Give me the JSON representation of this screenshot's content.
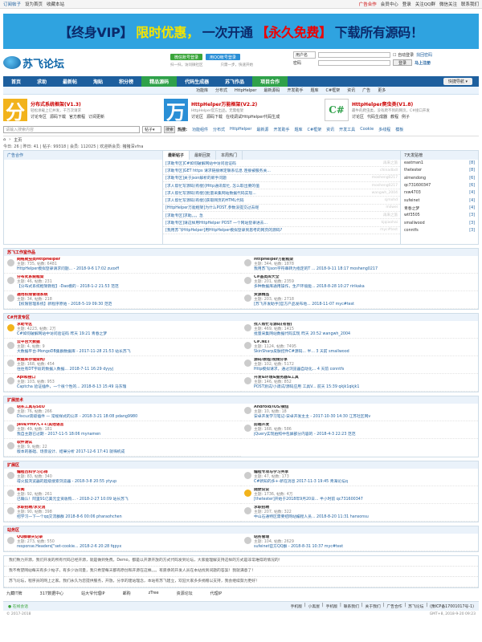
{
  "topbar": {
    "left": [
      "订阅帖子",
      "设为首页",
      "收藏本站"
    ],
    "right_red": "广告合作",
    "right": [
      "会员中心",
      "登录",
      "关注QQ群",
      "微信关注",
      "联系我们"
    ]
  },
  "banner": {
    "p1": "【终身VIP】",
    "p2": "限时优惠，",
    "p3": "一次开通",
    "p4": "【永久免费】",
    "p5": "下载所有源码！"
  },
  "logo": {
    "text": "苏飞论坛"
  },
  "login": {
    "wechat": "微信账号登录",
    "qq": "用QQ帐号登录",
    "wechat_sub": "扫一扫，访问微社区",
    "qq_sub": "只需一步，快速开始"
  },
  "form": {
    "account": "用户名",
    "password": "密码",
    "remember": "自动登录",
    "forgot": "找回密码",
    "login_btn": "登录",
    "register": "马上注册"
  },
  "nav": {
    "items": [
      "首页",
      "求助",
      "最新帖",
      "淘贴",
      "积分榜",
      "精品源码",
      "代码生成器",
      "苏飞作品",
      "项目合作"
    ],
    "quick": "快捷导航"
  },
  "subnav": [
    "功能库",
    "分布式",
    "HttpHelper",
    "最新源码",
    "开发助手",
    "题库",
    "C#框架",
    "资讯",
    "广告",
    "更多"
  ],
  "promos": [
    {
      "icon": "分",
      "title": "分布式系统框架(V1.3)",
      "desc": "轻松承载上亿并发，千万次请求",
      "links": [
        "讨论专区",
        "源码下载",
        "官方教程",
        "订阅更新"
      ]
    },
    {
      "icon": "万",
      "title": "HttpHelper万能框架(V2.2)",
      "desc": "HttpHelper官方出品，无需框架",
      "links": [
        "讨论区",
        "源码下载",
        "在线调试HttpHelper代码生成"
      ]
    },
    {
      "icon": "C#",
      "title": "HttpHelper爬虫类(V1.8)",
      "desc": "最牛的爬虫类，没有爬不到的网页，C#接口开发",
      "links": [
        "讨论区",
        "代码生成器",
        "教程",
        "例子"
      ]
    }
  ],
  "search": {
    "placeholder": "请输入搜索内容",
    "type": "帖子",
    "button": "搜索",
    "hot_label": "热搜:",
    "hot": [
      "功能组件",
      "分布式",
      "HttpHelper",
      "最新源",
      "开发助手",
      "题库",
      "C#框架",
      "资讯",
      "开发工具",
      "Cookie",
      "多线程",
      "模板"
    ]
  },
  "crumb": [
    "首页",
    "主页"
  ],
  "stats": "今日: 26 | 昨日: 41 | 帖子: 99318 | 会员: 112025 | 欢迎新会员: 猪猪深vfna",
  "ad_title": "广告合作",
  "tabs": [
    "最新帖子",
    "最新回复",
    "本周热门"
  ],
  "new_posts": [
    {
      "t": "[求助专区]C#如何破解网站中访问验证码",
      "u": "再来之旅"
    },
    {
      "t": "[求助专区]GET https 请求链接绑定联系信息 连接被服务关...",
      "u": "chinadbdl"
    },
    {
      "t": "[求助专区]关于json解析的新手问题",
      "u": "mosheng0217"
    },
    {
      "t": "[求人帮忙写源码(有偿)]Http通讯帮忙, 怎么取出要的值",
      "u": "mosheng0217"
    },
    {
      "t": "[求人帮忙写源码(有偿)]批量采集网站数据代码实现...",
      "u": "wangwh_2004"
    },
    {
      "t": "[求人帮忙写源码(有偿)]获取网页的HTML代码",
      "u": "sjmxhd"
    },
    {
      "t": "[HttpHelper万能框架]为什么POST,参数没提交过去呢",
      "u": "milwei"
    },
    {
      "t": "[求助专区]求助。。。急",
      "u": "再来之旅"
    },
    {
      "t": "[求助专区]请这样用HttpHelper POST 一个网站登录进去...",
      "u": "kjqiaohai"
    },
    {
      "t": "[我用苏飞HttpHelper]用HttpHelper模拟登录到思考的网页的源码?",
      "u": "myc#test"
    }
  ],
  "top_users": {
    "title": "7天发贴榜",
    "users": [
      [
        "eastman1",
        "[8]"
      ],
      [
        "thetester",
        "[8]"
      ],
      [
        "almendong",
        "[6]"
      ],
      [
        "qc731600347",
        "[6]"
      ],
      [
        "rxw4703",
        "[4]"
      ],
      [
        "sufeinet",
        "[4]"
      ],
      [
        "青春之梦",
        "[4]"
      ],
      [
        "wtf3505",
        "[3]"
      ],
      [
        "smallwood",
        "[3]"
      ],
      [
        "conntfs",
        "[3]"
      ]
    ]
  },
  "sections": [
    {
      "title": "苏飞工作室作品",
      "forums": [
        {
          "n": "网络爬虫类HttpHelper",
          "c": "主题: 735, 帖数: 6481",
          "l": "HttpHelper模拟登录请求问题... - 2018-9-6 17:02 zuoxff",
          "new": false
        },
        {
          "n": "HttpHelper万能框架",
          "c": "主题: 344, 帖数: 1878",
          "l": "我用苏飞json字符串转为指定的T ... 2018-9-11 18:17 mosheng0217",
          "new": false
        },
        {
          "n": "分布式系统框架",
          "c": "主题: 46, 帖数: 231",
          "l": "【分布式系统框架教程】-Dao模的 - 2018-1-2 21:53 范范",
          "new": false
        },
        {
          "n": "C#基类库大全",
          "c": "主题: 201, 帖数: 2359",
          "l": "多种数据库通用操作，生产环境能... 2018-8-28 10:27 ririkaka",
          "new": false
        },
        {
          "n": "通用权限管理系统",
          "c": "主题: 34, 帖数: 218",
          "l": "【权限管理系统】新程序原始 - 2018-5-19 09:30 范范",
          "new": false
        },
        {
          "n": "资源精品",
          "c": "主题: 203, 帖数: 2718",
          "l": "[苏飞开发助手]官方产品发布地... 2018-11-07 myc#test",
          "new": false
        }
      ]
    },
    {
      "title": "C#开发专区",
      "forums": [
        {
          "n": "求助专区",
          "c": "主题: 4223, 帖数: 2万",
          "l": "C#如何破解网站中访问验证码 昨天 19:21 青春之梦",
          "new": true
        },
        {
          "n": "找人帮忙写源码(有偿)",
          "c": "主题: 469, 帖数: 1415",
          "l": "批量采集网站数据代码实现 昨天 20:52 wangwh_2004",
          "new": false
        },
        {
          "n": "云平台大数据",
          "c": "主题: 4, 帖数: 9",
          "l": "大数据平台-MongoDB集群数据库 - 2017-11-28 21:53 站长苏飞",
          "new": false
        },
        {
          "n": "C#.NET",
          "c": "主题: 1124, 帖数: 7495",
          "l": "SkinSharp皮肤控件C#源码... 半... 3 天前 smallwood",
          "new": false
        },
        {
          "n": "数据库存储架构/",
          "c": "主题: 168, 帖数: 454",
          "l": "往往有DT字段的数据入数据... 2018-7-11 16:29 dyyyj",
          "new": false
        },
        {
          "n": "源码/教程/视频分享",
          "c": "主题: 102, 帖数: 5172",
          "l": "Http模拟请求，通过浏览器自动化... 4 天前 conntfs",
          "new": false
        },
        {
          "n": "Api和接口",
          "c": "主题: 103, 帖数: 953",
          "l": "Captcha 验证插件，一个很个性的... 2018-8-13 15:49 马东瑰",
          "new": false
        },
        {
          "n": "开发&环境&服务器&工具",
          "c": "主题: 146, 帖数: 852",
          "l": "POST测试/小调试/源码应用 工具V... 前天 15:39 qkjk1qkjk1",
          "new": false
        }
      ]
    },
    {
      "title": "扩展技术",
      "forums": [
        {
          "n": "站长工具与SEO",
          "c": "主题: 76, 帖数: 266",
          "l": "Discuz高级插件 — 常规样式的公开 - 2018-3-21 18:08 pdang9980",
          "new": false
        },
        {
          "n": "Android/iOS/微信",
          "c": "主题: 10, 帖数: 18",
          "l": "安卓开发学习笔记-安卓开发主主 - 2017-10-30 14:30 江苏社区网v",
          "new": false
        },
        {
          "n": "Java/PHP/C++/其他语言",
          "c": "主题: 49, 帖数: 181",
          "l": "我自主题已过期 - 2017-11-5 18:06 mynamen",
          "new": false
        },
        {
          "n": "前端开发",
          "c": "主题: 168, 帖数: 586",
          "l": "jQuery实现拍照中包屏部分内容的 - 2018-4-3 22:23 范范",
          "new": false
        },
        {
          "n": "软件测试",
          "c": "主题: 9, 帖数: 22",
          "l": "版本的基础、场景设计、结果分析 2017-12-6 17:41 就嗨机成",
          "new": false
        }
      ]
    },
    {
      "title": "扩展区",
      "forums": [
        {
          "n": "编程百科学习心得",
          "c": "主题: 83, 帖数: 340",
          "l": "得火狐浏览器的超级搜索浏览器 - 2018-3-8 20:55 ytyup",
          "new": false
        },
        {
          "n": "编程专项与学习共享",
          "c": "主题: 47, 帖数: 173",
          "l": "C#新知的多+-新在消息 2017-11-3 19:45 青海论坛q",
          "new": false
        },
        {
          "n": "新闻",
          "c": "主题: 92, 帖数: 261",
          "l": "已确认！阿里91亿美元全资收购... - 2018-2-27 10:09 站长苏飞",
          "new": false
        },
        {
          "n": "随便说说",
          "c": "主题: 1736, 帖数: 4万",
          "l": "[thetester]开始于2018年9月20日... 半小时前 qc731600347",
          "new": true
        },
        {
          "n": "求职招聘/求交流",
          "c": "主题: 90, 帖数: 398",
          "l": "招学习一下一个qq交流群群 2018-8-6 00:06 pharaohchen",
          "new": false
        },
        {
          "n": "求职招聘",
          "c": "主题: 207, 帖数: 322",
          "l": "中山石通特区需要招网站编程人员... 2018-8-20 11:31 hansonsu",
          "new": false
        }
      ]
    },
    {
      "title": "站务区",
      "forums": [
        {
          "n": "QQ群聊天记录",
          "c": "主题: 273, 帖数: 550",
          "l": "response.Headers[\"set-cookie... 2018-2-6 20:28 fqpyx",
          "new": false
        },
        {
          "n": "站务管理",
          "c": "主题: 104, 帖数: 2629",
          "l": "sufeinet官方QQ群 - 2018-8-31 10:37 myc#test",
          "new": false
        }
      ]
    }
  ],
  "footer_lines": [
    "我们致力开源，我们开发的所有代码已经开源，就是做到免费。Demo，都是以开源开放的方式代码发到论坛，大家能理解支持这样的方式是非常难得的情况的！",
    "我不希望网站每天有多少帖子，有多少访问量，我只希望每天都有原创和开源在这棒。。。有愿承的开发人员在本站找到间题的答案！我就满意了！",
    "苏飞论坛，程序员的网上之家。我们永久为您提供服务，开放，分享的建站理念，本站有苏飞建立，欢迎大家多多捐赠以支持，我会继续努力更好！"
  ],
  "links": [
    "九藏IT牌",
    "317数据中心",
    "站大爷代理IP",
    "邮购",
    "zTree",
    "资源论坛",
    "代理IP"
  ],
  "bottom": {
    "online": "在线会话",
    "items": [
      "手机版",
      "小黑屋",
      "手机版",
      "联系我们",
      "关于我们",
      "广告合作",
      "苏飞论坛",
      "(豫ICP备17001017号-1)"
    ]
  },
  "copyright": "© 2017-2018",
  "time": "GMT+8, 2018-9-20 09:23"
}
